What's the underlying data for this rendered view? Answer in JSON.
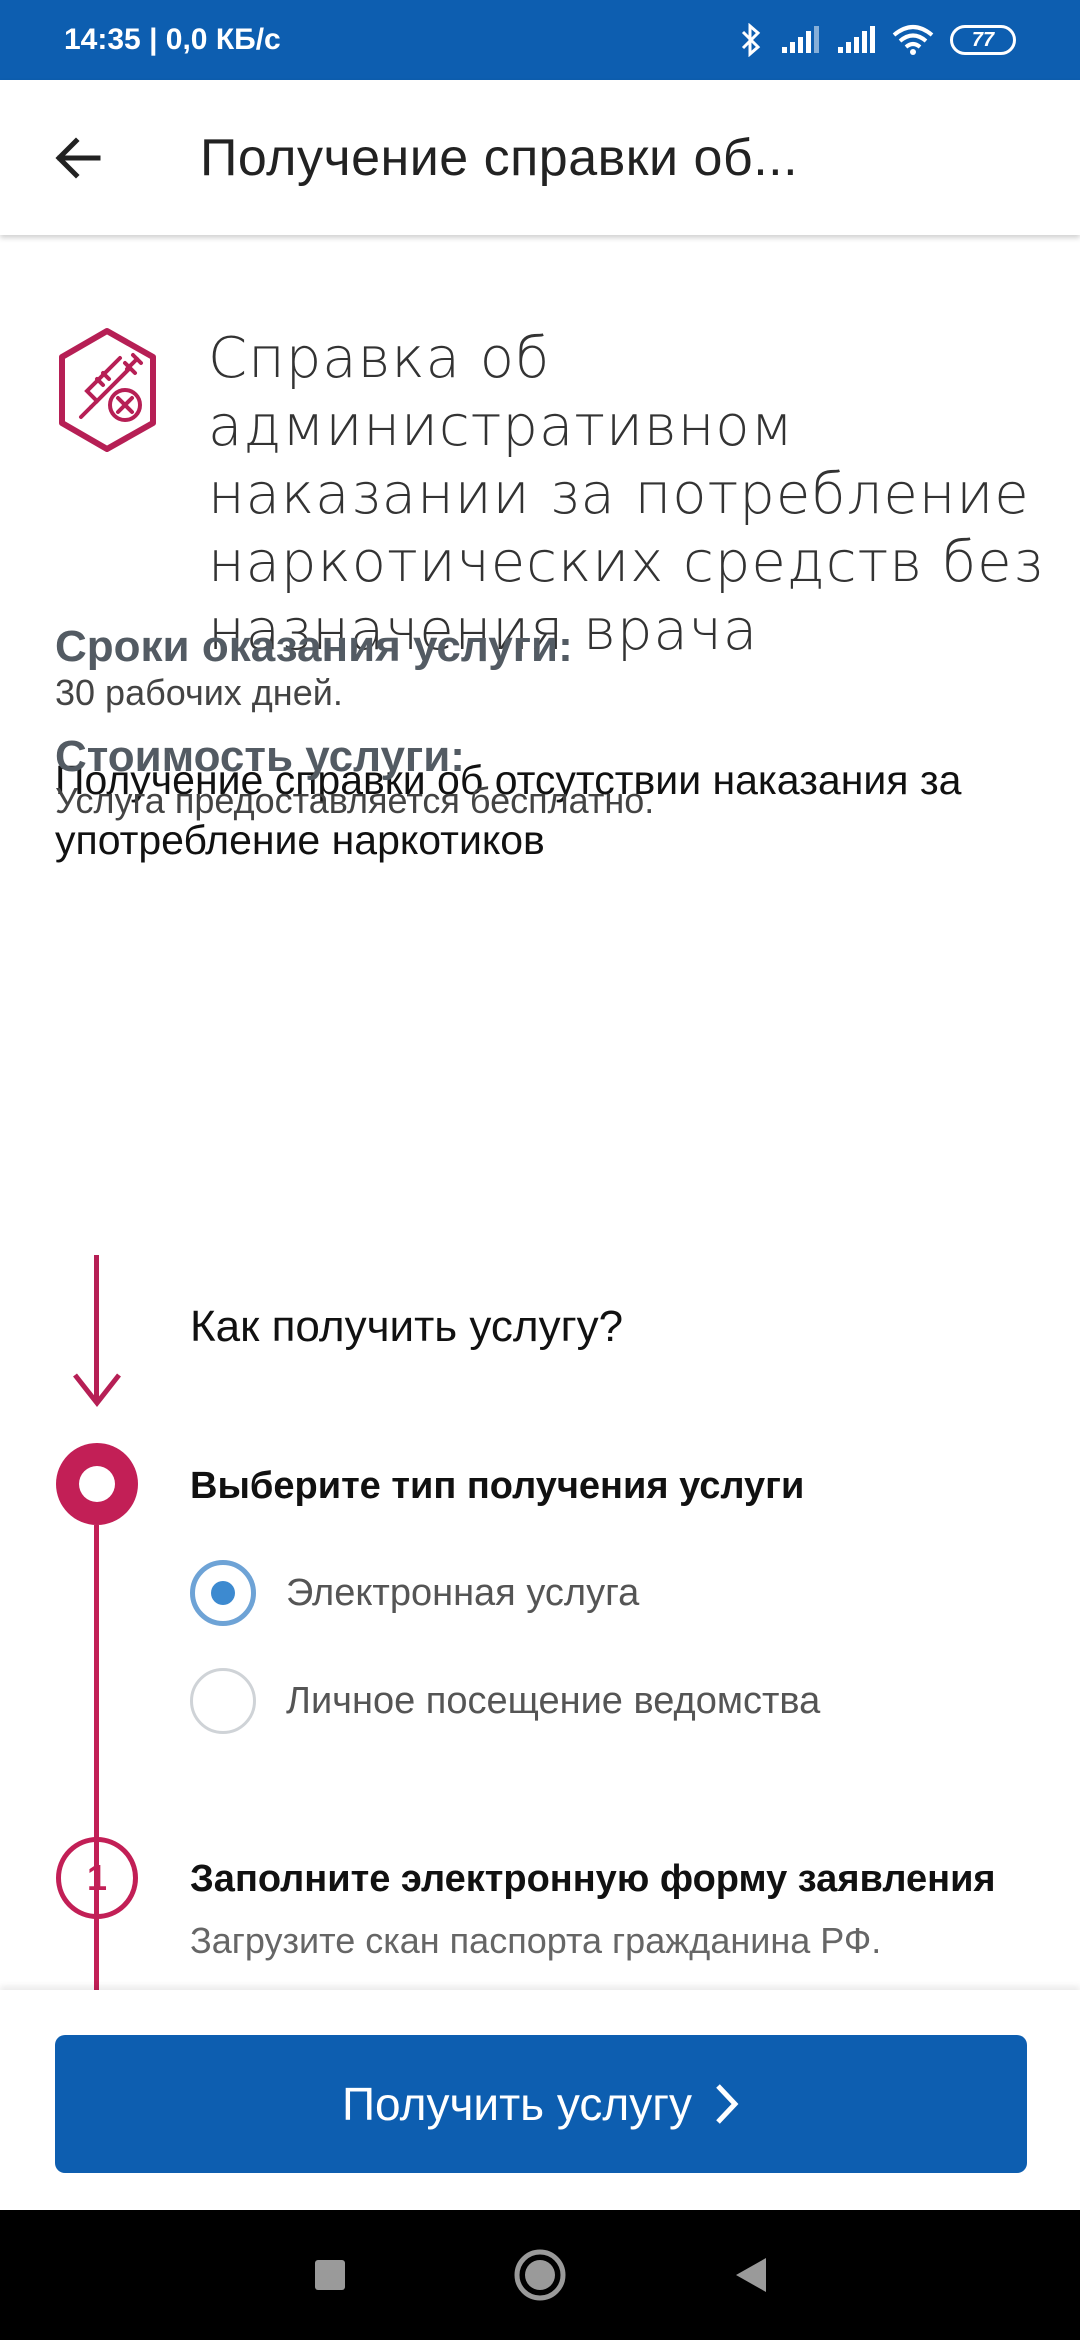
{
  "status_bar": {
    "time_speed": "14:35 | 0,0 КБ/с",
    "battery": "77",
    "icons": [
      "bluetooth-icon",
      "signal-icon",
      "signal-icon",
      "wifi-icon",
      "battery-icon"
    ]
  },
  "app_bar": {
    "title": "Получение справки об...",
    "back_icon": "arrow-left-icon"
  },
  "hero": {
    "icon": "syringe-cross-icon",
    "title": "Справка об административном наказании за потребление наркотических средств без назначения врача"
  },
  "description": "Получение справки об отсутствии наказания за употребление наркотиков",
  "terms": {
    "label": "Сроки оказания услуги:",
    "value": "30 рабочих дней."
  },
  "cost": {
    "label": "Стоимость услуги:",
    "value": "Услуга предоставляется бесплатно."
  },
  "how_to": {
    "title": "Как получить услугу?",
    "step_select": {
      "title": "Выберите тип получения услуги",
      "options": [
        {
          "label": "Электронная услуга",
          "selected": true
        },
        {
          "label": "Личное посещение ведомства",
          "selected": false
        }
      ]
    },
    "step_1": {
      "number": "1",
      "title": "Заполните электронную форму заявления",
      "subtitle": "Загрузите скан паспорта гражданина РФ."
    }
  },
  "cta": {
    "label": "Получить услугу"
  },
  "colors": {
    "brand_blue": "#0d5eb0",
    "accent_crimson": "#c21f56",
    "radio_blue": "#3d8ad0"
  }
}
